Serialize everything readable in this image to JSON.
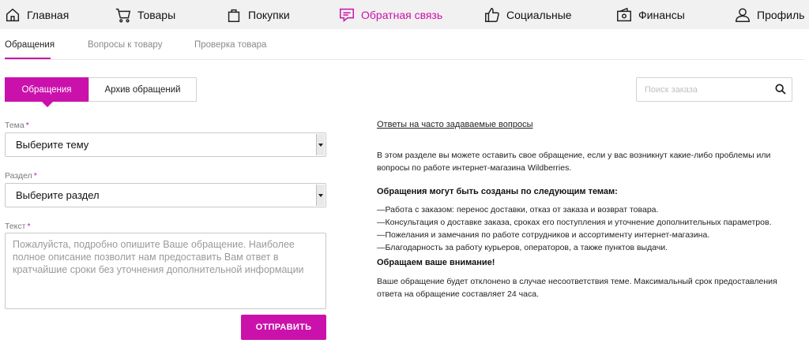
{
  "nav": {
    "items": [
      {
        "label": "Главная",
        "icon": "home-icon"
      },
      {
        "label": "Товары",
        "icon": "cart-icon"
      },
      {
        "label": "Покупки",
        "icon": "bag-icon"
      },
      {
        "label": "Обратная связь",
        "icon": "feedback-icon",
        "active": true
      },
      {
        "label": "Социальные",
        "icon": "thumbs-up-icon"
      },
      {
        "label": "Финансы",
        "icon": "wallet-icon"
      },
      {
        "label": "Профиль",
        "icon": "user-icon"
      }
    ],
    "accent_color": "#cb11ab"
  },
  "subtabs": {
    "items": [
      {
        "label": "Обращения",
        "active": true
      },
      {
        "label": "Вопросы к товару"
      },
      {
        "label": "Проверка товара"
      }
    ]
  },
  "toggle": {
    "active_label": "Обращения",
    "archive_label": "Архив обращений"
  },
  "search": {
    "placeholder": "Поиск заказа",
    "icon": "search-icon"
  },
  "form": {
    "topic_label": "Тема",
    "topic_value": "Выберите тему",
    "section_label": "Раздел",
    "section_value": "Выберите раздел",
    "text_label": "Текст",
    "required_mark": "*",
    "text_placeholder": "Пожалуйста, подробно опишите Ваше обращение. Наиболее полное описание позволит нам предоставить Вам ответ в кратчайшие сроки без уточнения дополнительной информации",
    "submit_label": "ОТПРАВИТЬ"
  },
  "info": {
    "faq_link": "Ответы на часто задаваемые вопросы",
    "intro": "В этом разделе вы можете оставить свое обращение, если у вас возникнут какие-либо проблемы или вопросы по работе интернет-магазина Wildberries.",
    "topics_heading": "Обращения могут быть созданы по следующим темам:",
    "topics": [
      "—Работа с заказом: перенос доставки, отказ от заказа и возврат товара.",
      "—Консультация о доставке заказа, сроках его поступления и уточнение дополнительных параметров.",
      "—Пожелания и замечания по работе сотрудников и ассортименту интернет-магазина.",
      "—Благодарность за работу курьеров, операторов, а также пунктов выдачи."
    ],
    "attention_heading": "Обращаем ваше внимание!",
    "attention_text": "Ваше обращение будет отклонено в случае несоответствия теме. Максимальный срок предоставления ответа на обращение составляет 24 часа."
  }
}
